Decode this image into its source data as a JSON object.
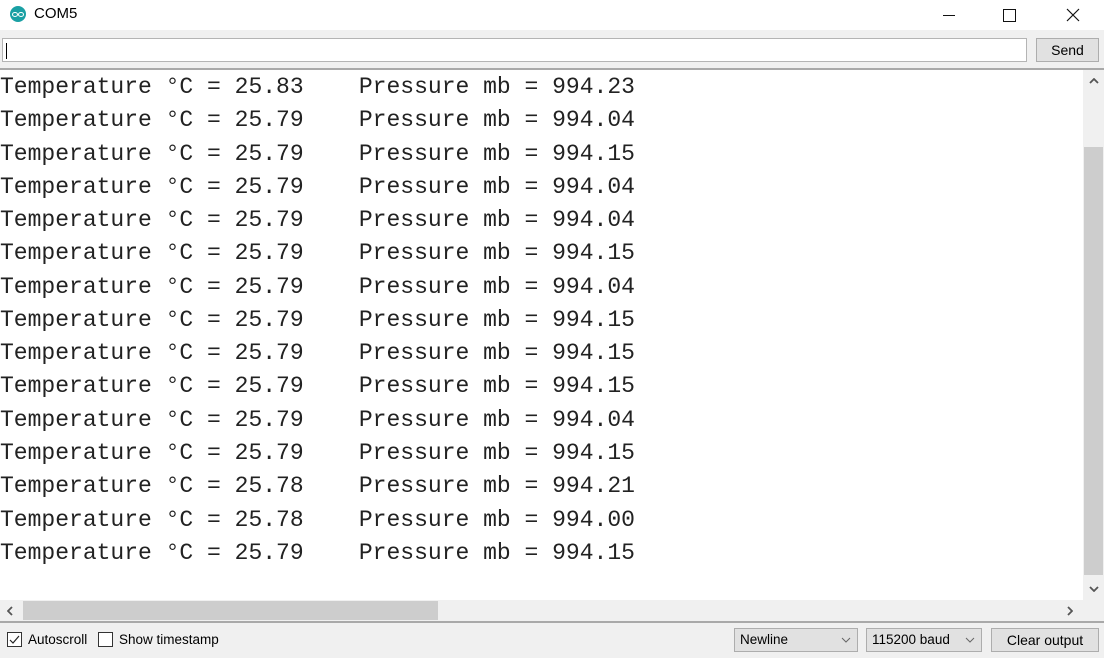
{
  "window": {
    "title": "COM5",
    "app_icon": "arduino-icon",
    "controls": {
      "minimize": "minimize-icon",
      "maximize": "maximize-icon",
      "close": "close-icon"
    }
  },
  "send_bar": {
    "input_value": "",
    "send_label": "Send"
  },
  "output": {
    "lines": [
      {
        "temp_label": "Temperature °C = ",
        "temp": "25.83",
        "pressure_label": "Pressure mb = ",
        "pressure": "994.23"
      },
      {
        "temp_label": "Temperature °C = ",
        "temp": "25.79",
        "pressure_label": "Pressure mb = ",
        "pressure": "994.04"
      },
      {
        "temp_label": "Temperature °C = ",
        "temp": "25.79",
        "pressure_label": "Pressure mb = ",
        "pressure": "994.15"
      },
      {
        "temp_label": "Temperature °C = ",
        "temp": "25.79",
        "pressure_label": "Pressure mb = ",
        "pressure": "994.04"
      },
      {
        "temp_label": "Temperature °C = ",
        "temp": "25.79",
        "pressure_label": "Pressure mb = ",
        "pressure": "994.04"
      },
      {
        "temp_label": "Temperature °C = ",
        "temp": "25.79",
        "pressure_label": "Pressure mb = ",
        "pressure": "994.15"
      },
      {
        "temp_label": "Temperature °C = ",
        "temp": "25.79",
        "pressure_label": "Pressure mb = ",
        "pressure": "994.04"
      },
      {
        "temp_label": "Temperature °C = ",
        "temp": "25.79",
        "pressure_label": "Pressure mb = ",
        "pressure": "994.15"
      },
      {
        "temp_label": "Temperature °C = ",
        "temp": "25.79",
        "pressure_label": "Pressure mb = ",
        "pressure": "994.15"
      },
      {
        "temp_label": "Temperature °C = ",
        "temp": "25.79",
        "pressure_label": "Pressure mb = ",
        "pressure": "994.15"
      },
      {
        "temp_label": "Temperature °C = ",
        "temp": "25.79",
        "pressure_label": "Pressure mb = ",
        "pressure": "994.04"
      },
      {
        "temp_label": "Temperature °C = ",
        "temp": "25.79",
        "pressure_label": "Pressure mb = ",
        "pressure": "994.15"
      },
      {
        "temp_label": "Temperature °C = ",
        "temp": "25.78",
        "pressure_label": "Pressure mb = ",
        "pressure": "994.21"
      },
      {
        "temp_label": "Temperature °C = ",
        "temp": "25.78",
        "pressure_label": "Pressure mb = ",
        "pressure": "994.00"
      },
      {
        "temp_label": "Temperature °C = ",
        "temp": "25.79",
        "pressure_label": "Pressure mb = ",
        "pressure": "994.15"
      }
    ]
  },
  "footer": {
    "autoscroll_label": "Autoscroll",
    "autoscroll_checked": true,
    "timestamp_label": "Show timestamp",
    "timestamp_checked": false,
    "line_ending": "Newline",
    "baud_rate": "115200 baud",
    "clear_label": "Clear output"
  }
}
